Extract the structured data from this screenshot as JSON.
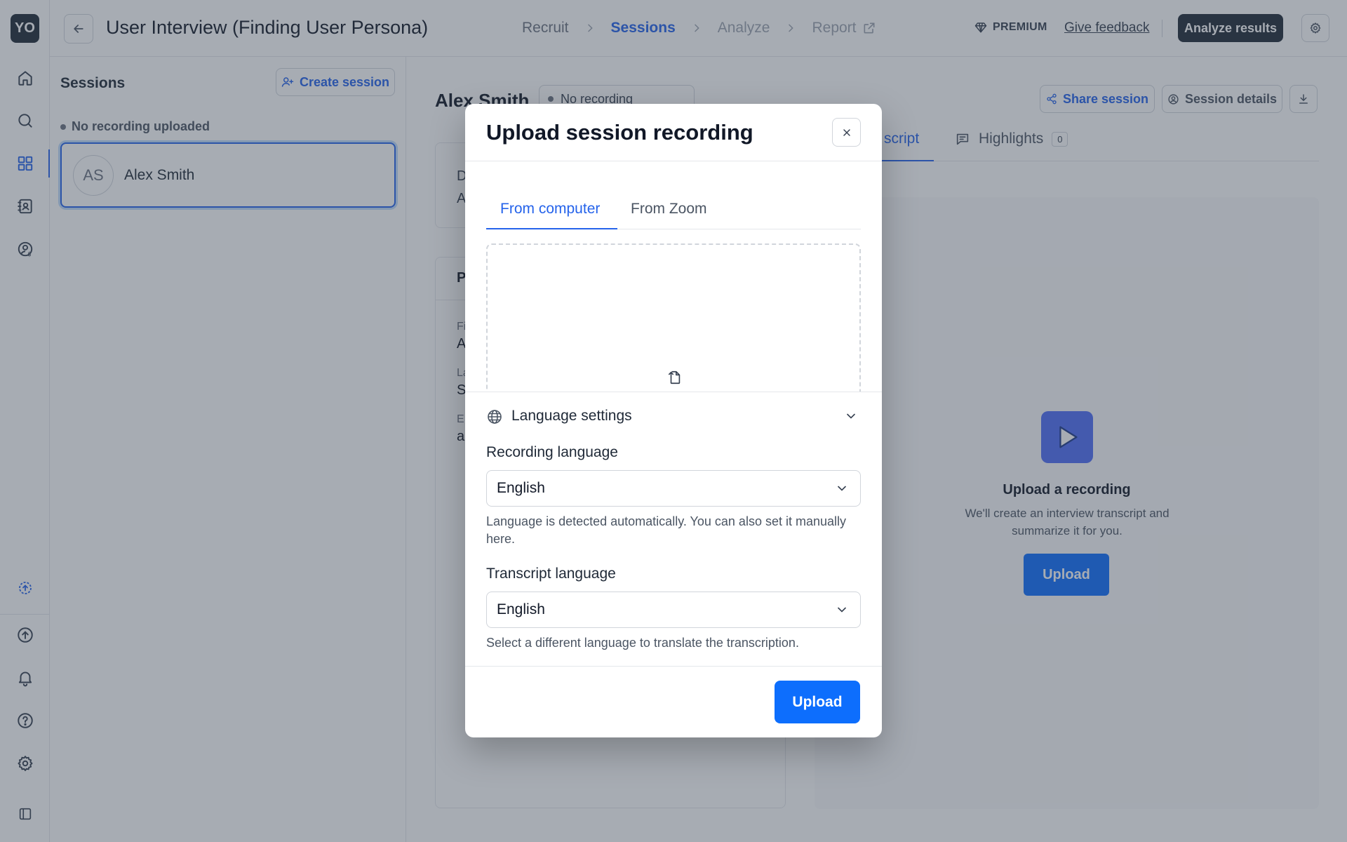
{
  "app": {
    "logo_text": "YO",
    "page_title": "User Interview (Finding User Persona)",
    "colors": {
      "accent": "#2563eb",
      "primary_button": "#0d6efd",
      "dark_button": "#1f2937"
    }
  },
  "rail": {
    "icons": [
      "home-icon",
      "search-icon",
      "grid-icon",
      "contacts-icon",
      "user-dollar-icon",
      "upload-status-icon",
      "cloud-upload-icon",
      "bell-icon",
      "help-icon",
      "gear-icon",
      "collapse-sidebar-icon"
    ],
    "active": "grid-icon"
  },
  "header": {
    "steps": [
      "Recruit",
      "Sessions",
      "Analyze",
      "Report"
    ],
    "current_step": "Sessions",
    "premium_label": "PREMIUM",
    "feedback_label": "Give feedback",
    "analyze_label": "Analyze results"
  },
  "sessions": {
    "title": "Sessions",
    "create_label": "Create session",
    "group_label": "No recording uploaded",
    "items": [
      {
        "initials": "AS",
        "name": "Alex Smith"
      }
    ]
  },
  "session_view": {
    "participant_name": "Alex Smith",
    "recording_status": "No recording",
    "share_label": "Share session",
    "details_label": "Session details",
    "card1": {
      "title": "D",
      "value": "A"
    },
    "card2": {
      "title": "P",
      "fields": [
        {
          "label": "Fi",
          "value": "A"
        },
        {
          "label": "La",
          "value": "S"
        },
        {
          "label": "E",
          "value": "a"
        }
      ]
    },
    "tabs": {
      "transcript_partial": "script",
      "highlights": "Highlights",
      "highlights_count": "0"
    },
    "empty": {
      "title": "Upload a recording",
      "subtitle": "We'll create an interview transcript and summarize it for you.",
      "button": "Upload"
    }
  },
  "modal": {
    "title": "Upload session recording",
    "tabs": [
      "From computer",
      "From Zoom"
    ],
    "active_tab": "From computer",
    "language_settings_label": "Language settings",
    "recording_language": {
      "label": "Recording language",
      "value": "English",
      "help": "Language is detected automatically. You can also set it manually here."
    },
    "transcript_language": {
      "label": "Transcript language",
      "value": "English",
      "help": "Select a different language to translate the transcription."
    },
    "upload_label": "Upload"
  }
}
